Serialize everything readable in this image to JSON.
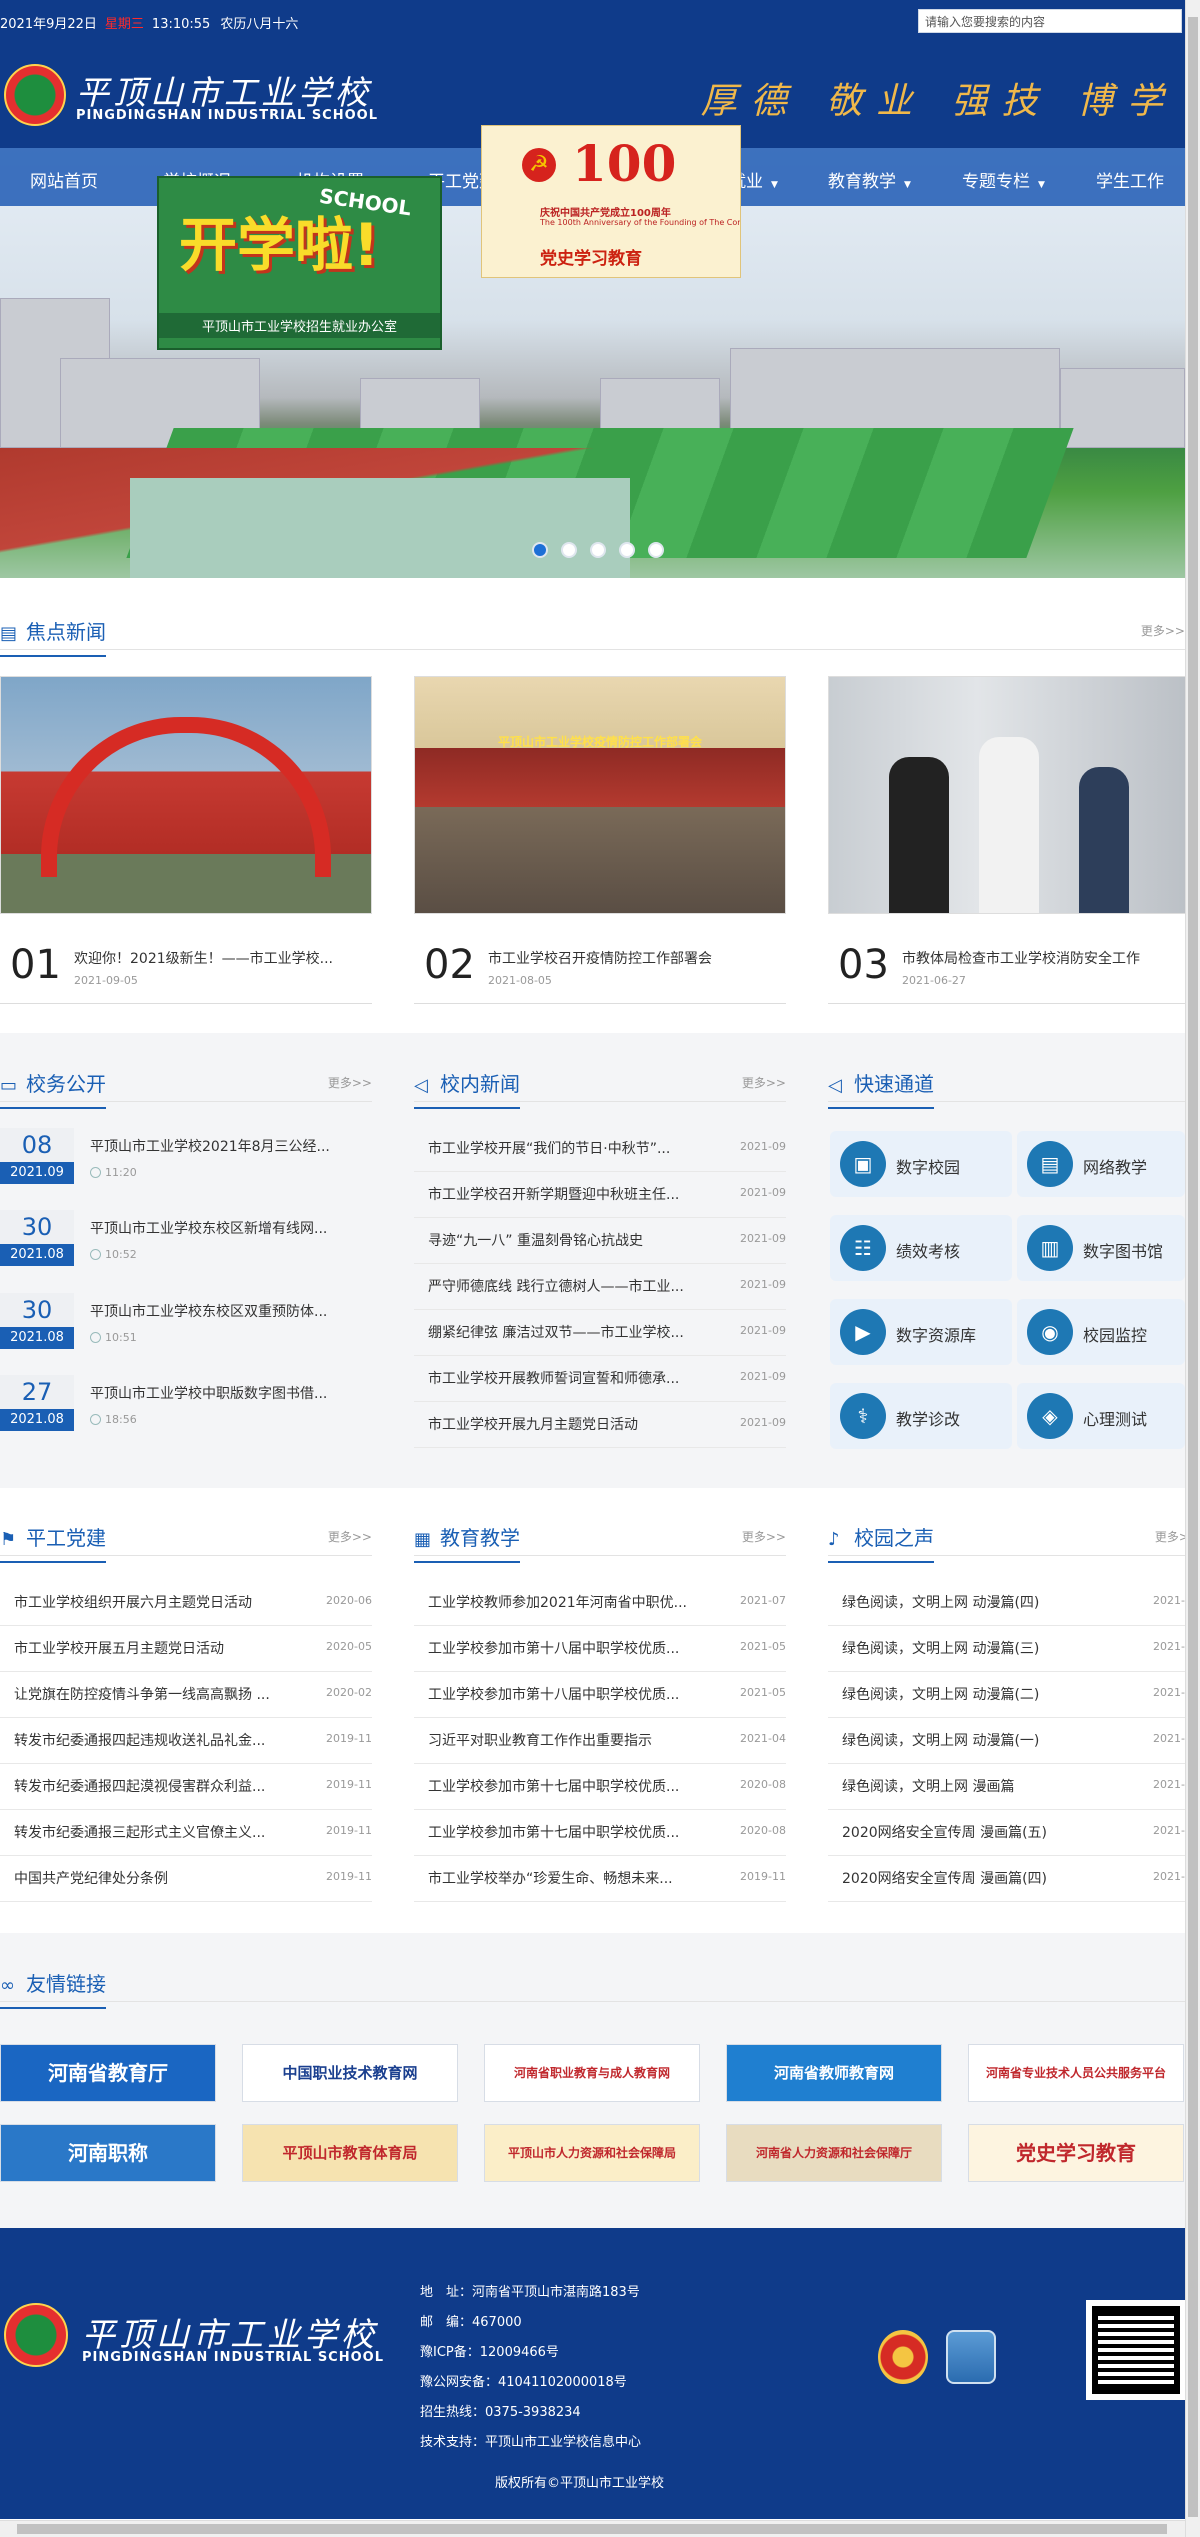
{
  "topbar": {
    "date": "2021年9月22日",
    "weekday": "星期三",
    "time": "13:10:55",
    "lunar": "农历八月十六",
    "search_placeholder": "请输入您要搜索的内容"
  },
  "header": {
    "school_cn": "平顶山市工业学校",
    "school_en": "PINGDINGSHAN INDUSTRIAL SCHOOL",
    "motto": "厚德 敬业 强技 博学"
  },
  "nav": {
    "items": [
      {
        "label": "网站首页",
        "arrow": false
      },
      {
        "label": "学校概况",
        "arrow": false
      },
      {
        "label": "机构设置",
        "arrow": false
      },
      {
        "label": "平工党建",
        "arrow": false
      },
      {
        "label": "招生就业",
        "arrow": true
      },
      {
        "label": "教育教学",
        "arrow": true
      },
      {
        "label": "专题专栏",
        "arrow": true
      },
      {
        "label": "学生工作",
        "arrow": false
      }
    ],
    "arrow_glyph": "▼"
  },
  "floats": {
    "kaixue": {
      "big": "开学啦!",
      "school": "SCHOOL",
      "caption": "平顶山市工业学校招生就业办公室"
    },
    "dangshi": {
      "hundred": "100",
      "line1": "庆祝中国共产党成立100周年",
      "line2": "The 100th Anniversary of the Founding of The Communist Party of China",
      "line3": "党史学习教育"
    }
  },
  "banner": {
    "dots": 5,
    "active": 0
  },
  "focus": {
    "title": "焦点新闻",
    "more": "更多>>",
    "items": [
      {
        "num": "01",
        "title": "欢迎你！2021级新生！——市工业学校...",
        "date": "2021-09-05"
      },
      {
        "num": "02",
        "title": "市工业学校召开疫情防控工作部署会",
        "date": "2021-08-05"
      },
      {
        "num": "03",
        "title": "市教体局检查市工业学校消防安全工作",
        "date": "2021-06-27"
      }
    ],
    "img2_banner": "平顶山市工业学校疫情防控工作部署会"
  },
  "affairs": {
    "title": "校务公开",
    "more": "更多>>",
    "items": [
      {
        "day": "08",
        "month": "2021.09",
        "title": "平顶山市工业学校2021年8月三公经...",
        "time": "11:20"
      },
      {
        "day": "30",
        "month": "2021.08",
        "title": "平顶山市工业学校东校区新增有线网...",
        "time": "10:52"
      },
      {
        "day": "30",
        "month": "2021.08",
        "title": "平顶山市工业学校东校区双重预防体...",
        "time": "10:51"
      },
      {
        "day": "27",
        "month": "2021.08",
        "title": "平顶山市工业学校中职版数字图书借...",
        "time": "18:56"
      }
    ]
  },
  "campus_news": {
    "title": "校内新闻",
    "more": "更多>>",
    "items": [
      {
        "title": "市工业学校开展“我们的节日·中秋节”...",
        "date": "2021-09"
      },
      {
        "title": "市工业学校召开新学期暨迎中秋班主任...",
        "date": "2021-09"
      },
      {
        "title": "寻迹“九一八” 重温刻骨铭心抗战史",
        "date": "2021-09"
      },
      {
        "title": "严守师德底线 践行立德树人——市工业...",
        "date": "2021-09"
      },
      {
        "title": "绷紧纪律弦 廉洁过双节——市工业学校...",
        "date": "2021-09"
      },
      {
        "title": "市工业学校开展教师誓词宣誓和师德承...",
        "date": "2021-09"
      },
      {
        "title": "市工业学校开展九月主题党日活动",
        "date": "2021-09"
      }
    ]
  },
  "quick": {
    "title": "快速通道",
    "items": [
      {
        "label": "数字校园",
        "icon": "monitor-icon",
        "glyph": "▣"
      },
      {
        "label": "网络教学",
        "icon": "film-icon",
        "glyph": "▤"
      },
      {
        "label": "绩效考核",
        "icon": "clipboard-icon",
        "glyph": "☷"
      },
      {
        "label": "数字图书馆",
        "icon": "books-icon",
        "glyph": "▥"
      },
      {
        "label": "数字资源库",
        "icon": "video-icon",
        "glyph": "▶"
      },
      {
        "label": "校园监控",
        "icon": "camera-icon",
        "glyph": "◉"
      },
      {
        "label": "教学诊改",
        "icon": "stethoscope-icon",
        "glyph": "⚕"
      },
      {
        "label": "心理测试",
        "icon": "layers-icon",
        "glyph": "◈"
      }
    ]
  },
  "party": {
    "title": "平工党建",
    "more": "更多>>",
    "items": [
      {
        "title": "市工业学校组织开展六月主题党日活动",
        "date": "2020-06"
      },
      {
        "title": "市工业学校开展五月主题党日活动",
        "date": "2020-05"
      },
      {
        "title": "让党旗在防控疫情斗争第一线高高飘扬 ...",
        "date": "2020-02"
      },
      {
        "title": "转发市纪委通报四起违规收送礼品礼金...",
        "date": "2019-11"
      },
      {
        "title": "转发市纪委通报四起漠视侵害群众利益...",
        "date": "2019-11"
      },
      {
        "title": "转发市纪委通报三起形式主义官僚主义...",
        "date": "2019-11"
      },
      {
        "title": "中国共产党纪律处分条例",
        "date": "2019-11"
      }
    ]
  },
  "teaching": {
    "title": "教育教学",
    "more": "更多>>",
    "items": [
      {
        "title": "工业学校教师参加2021年河南省中职优...",
        "date": "2021-07"
      },
      {
        "title": "工业学校参加市第十八届中职学校优质...",
        "date": "2021-05"
      },
      {
        "title": "工业学校参加市第十八届中职学校优质...",
        "date": "2021-05"
      },
      {
        "title": "习近平对职业教育工作作出重要指示",
        "date": "2021-04"
      },
      {
        "title": "工业学校参加市第十七届中职学校优质...",
        "date": "2020-08"
      },
      {
        "title": "工业学校参加市第十七届中职学校优质...",
        "date": "2020-08"
      },
      {
        "title": "市工业学校举办“珍爱生命、畅想未来...",
        "date": "2019-11"
      }
    ]
  },
  "voice": {
    "title": "校园之声",
    "more": "更多>>",
    "items": [
      {
        "title": "绿色阅读，文明上网 动漫篇(四)",
        "date": "2021-"
      },
      {
        "title": "绿色阅读，文明上网 动漫篇(三)",
        "date": "2021-"
      },
      {
        "title": "绿色阅读，文明上网 动漫篇(二)",
        "date": "2021-"
      },
      {
        "title": "绿色阅读，文明上网 动漫篇(一)",
        "date": "2021-"
      },
      {
        "title": "绿色阅读，文明上网 漫画篇",
        "date": "2021-"
      },
      {
        "title": "2020网络安全宣传周 漫画篇(五)",
        "date": "2021-"
      },
      {
        "title": "2020网络安全宣传周 漫画篇(四)",
        "date": "2021-"
      }
    ]
  },
  "links": {
    "title": "友情链接",
    "items": [
      {
        "label": "河南省教育厅",
        "bg": "#1a66c2",
        "fg": "#ffffff"
      },
      {
        "label": "中国职业技术教育网",
        "bg": "#ffffff",
        "fg": "#1a3f8f"
      },
      {
        "label": "河南省职业教育与成人教育网",
        "bg": "#ffffff",
        "fg": "#c0282d"
      },
      {
        "label": "河南省教师教育网",
        "bg": "#1f7fd0",
        "fg": "#ffffff"
      },
      {
        "label": "河南省专业技术人员公共服务平台",
        "bg": "#ffffff",
        "fg": "#c0282d"
      },
      {
        "label": "河南职称",
        "bg": "#2a78c8",
        "fg": "#ffffff"
      },
      {
        "label": "平顶山市教育体育局",
        "bg": "#f6e3b0",
        "fg": "#c0282d"
      },
      {
        "label": "平顶山市人力资源和社会保障局",
        "bg": "#fbeec8",
        "fg": "#c0282d"
      },
      {
        "label": "河南省人力资源和社会保障厅",
        "bg": "#e8dcc0",
        "fg": "#c0282d"
      },
      {
        "label": "党史学习教育",
        "bg": "#fdf4e0",
        "fg": "#c0282d"
      }
    ]
  },
  "footer": {
    "school_cn": "平顶山市工业学校",
    "school_en": "PINGDINGSHAN INDUSTRIAL SCHOOL",
    "lines": [
      "地　址：河南省平顶山市湛南路183号",
      "邮　编：467000",
      "豫ICP备：12009466号",
      "豫公网安备：41041102000018号",
      "招生热线：0375-3938234",
      "技术支持：平顶山市工业学校信息中心"
    ],
    "copyright": "版权所有©平顶山市工业学校"
  }
}
